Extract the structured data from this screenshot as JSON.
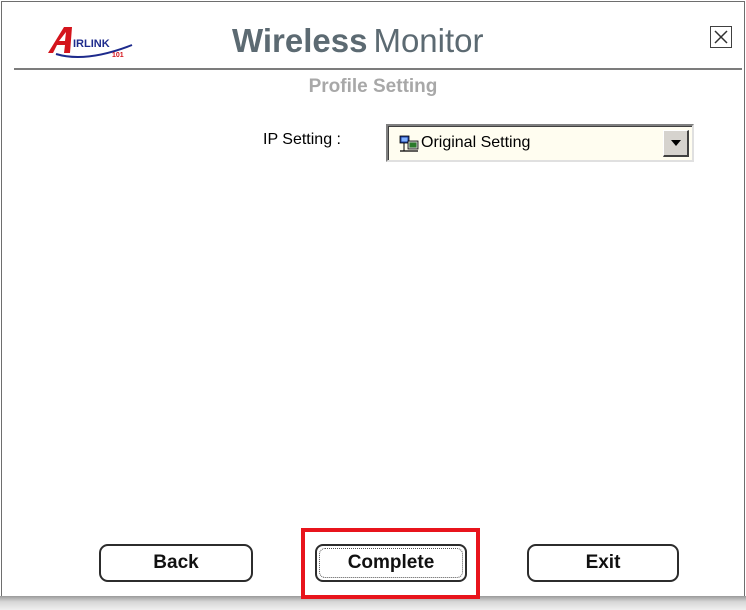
{
  "header": {
    "logo_text": "AIRLINK 101",
    "title_bold": "Wireless",
    "title_thin": "Monitor",
    "close_icon": "close-x-icon"
  },
  "page": {
    "subtitle": "Profile Setting"
  },
  "ip_setting": {
    "label": "IP Setting :",
    "selected_value": "Original Setting",
    "option_icon": "network-computers-icon"
  },
  "buttons": {
    "back_label": "Back",
    "complete_label": "Complete",
    "exit_label": "Exit"
  },
  "colors": {
    "title": "#5c6a72",
    "subtitle": "#a8a8a8",
    "highlight": "#e8141c",
    "select_bg": "#fffdf0",
    "logo_red": "#d4141c",
    "logo_blue": "#1d2a8c"
  }
}
